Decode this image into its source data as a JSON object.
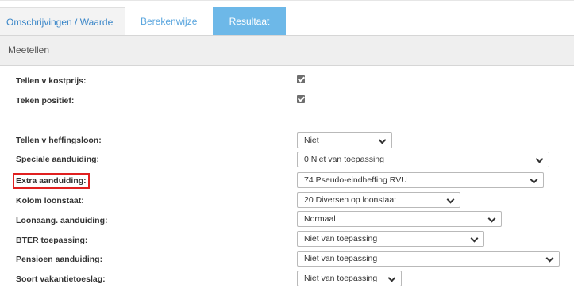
{
  "tabs": {
    "omschrijvingen": "Omschrijvingen / Waarde",
    "berekenwijze": "Berekenwijze",
    "resultaat": "Resultaat"
  },
  "section": {
    "title": "Meetellen"
  },
  "fields": {
    "tellen_kostprijs": {
      "label": "Tellen v kostprijs:",
      "checked": true
    },
    "teken_positief": {
      "label": "Teken positief:",
      "checked": true
    },
    "tellen_heffingsloon": {
      "label": "Tellen v heffingsloon:",
      "value": "Niet"
    },
    "speciale_aanduiding": {
      "label": "Speciale aanduiding:",
      "value": "0 Niet van toepassing"
    },
    "extra_aanduiding": {
      "label": "Extra aanduiding:",
      "value": "74 Pseudo-eindheffing RVU"
    },
    "kolom_loonstaat": {
      "label": "Kolom loonstaat:",
      "value": "20 Diversen op loonstaat"
    },
    "loonaang_aanduiding": {
      "label": "Loonaang. aanduiding:",
      "value": "Normaal"
    },
    "bter_toepassing": {
      "label": "BTER toepassing:",
      "value": "Niet van toepassing"
    },
    "pensioen_aanduiding": {
      "label": "Pensioen aanduiding:",
      "value": "Niet van toepassing"
    },
    "soort_vakantietoeslag": {
      "label": "Soort vakantietoeslag:",
      "value": "Niet van toepassing"
    }
  },
  "colors": {
    "accent": "#6db8e8",
    "link": "#3a86c8",
    "highlight": "#e02020"
  }
}
